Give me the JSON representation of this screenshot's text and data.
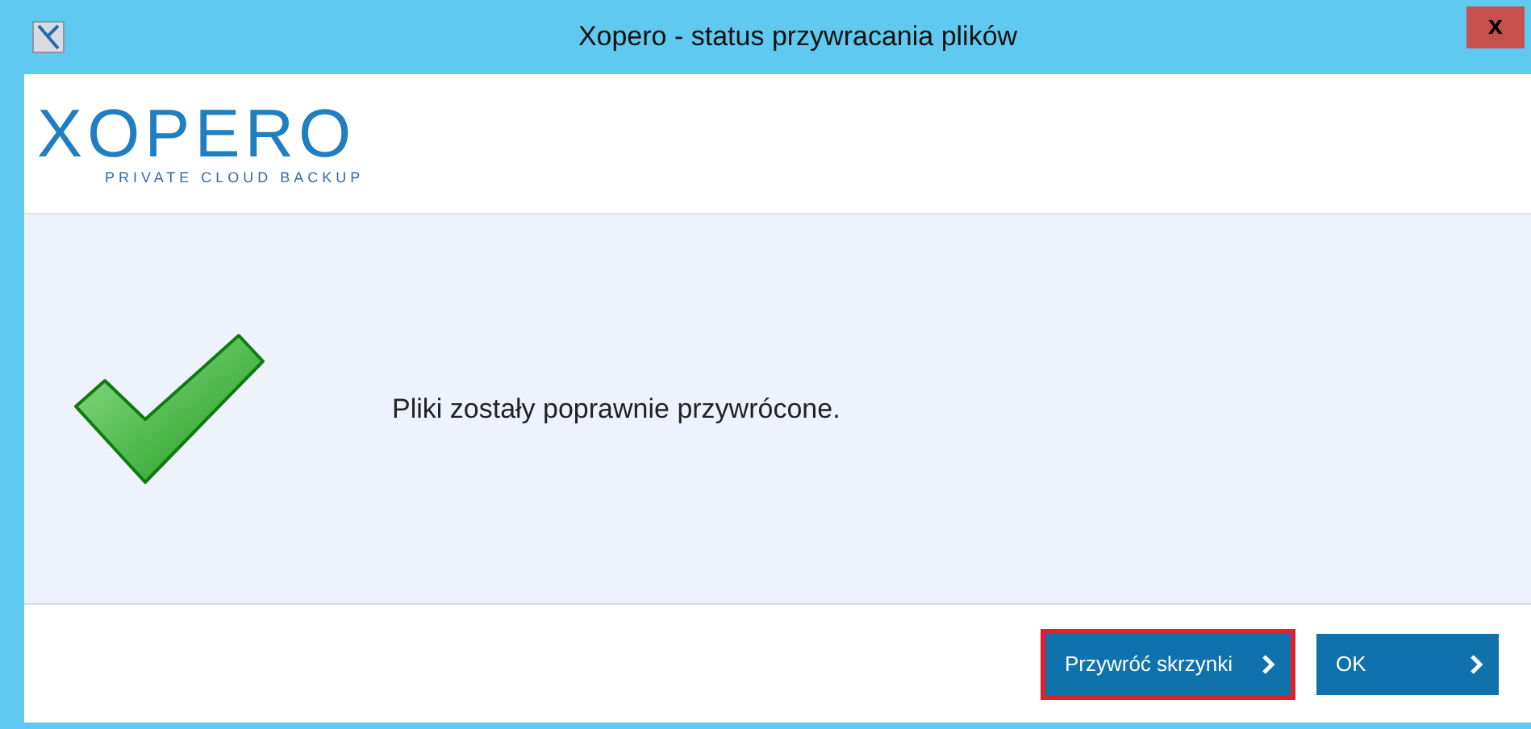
{
  "window": {
    "title": "Xopero - status przywracania plików",
    "close": "x"
  },
  "logo": {
    "name": "XOPERO",
    "tagline": "PRIVATE CLOUD BACKUP"
  },
  "message": "Pliki zostały poprawnie przywrócone.",
  "buttons": [
    {
      "label": "Przywróć skrzynki",
      "focused": true
    },
    {
      "label": "OK",
      "focused": false
    }
  ]
}
